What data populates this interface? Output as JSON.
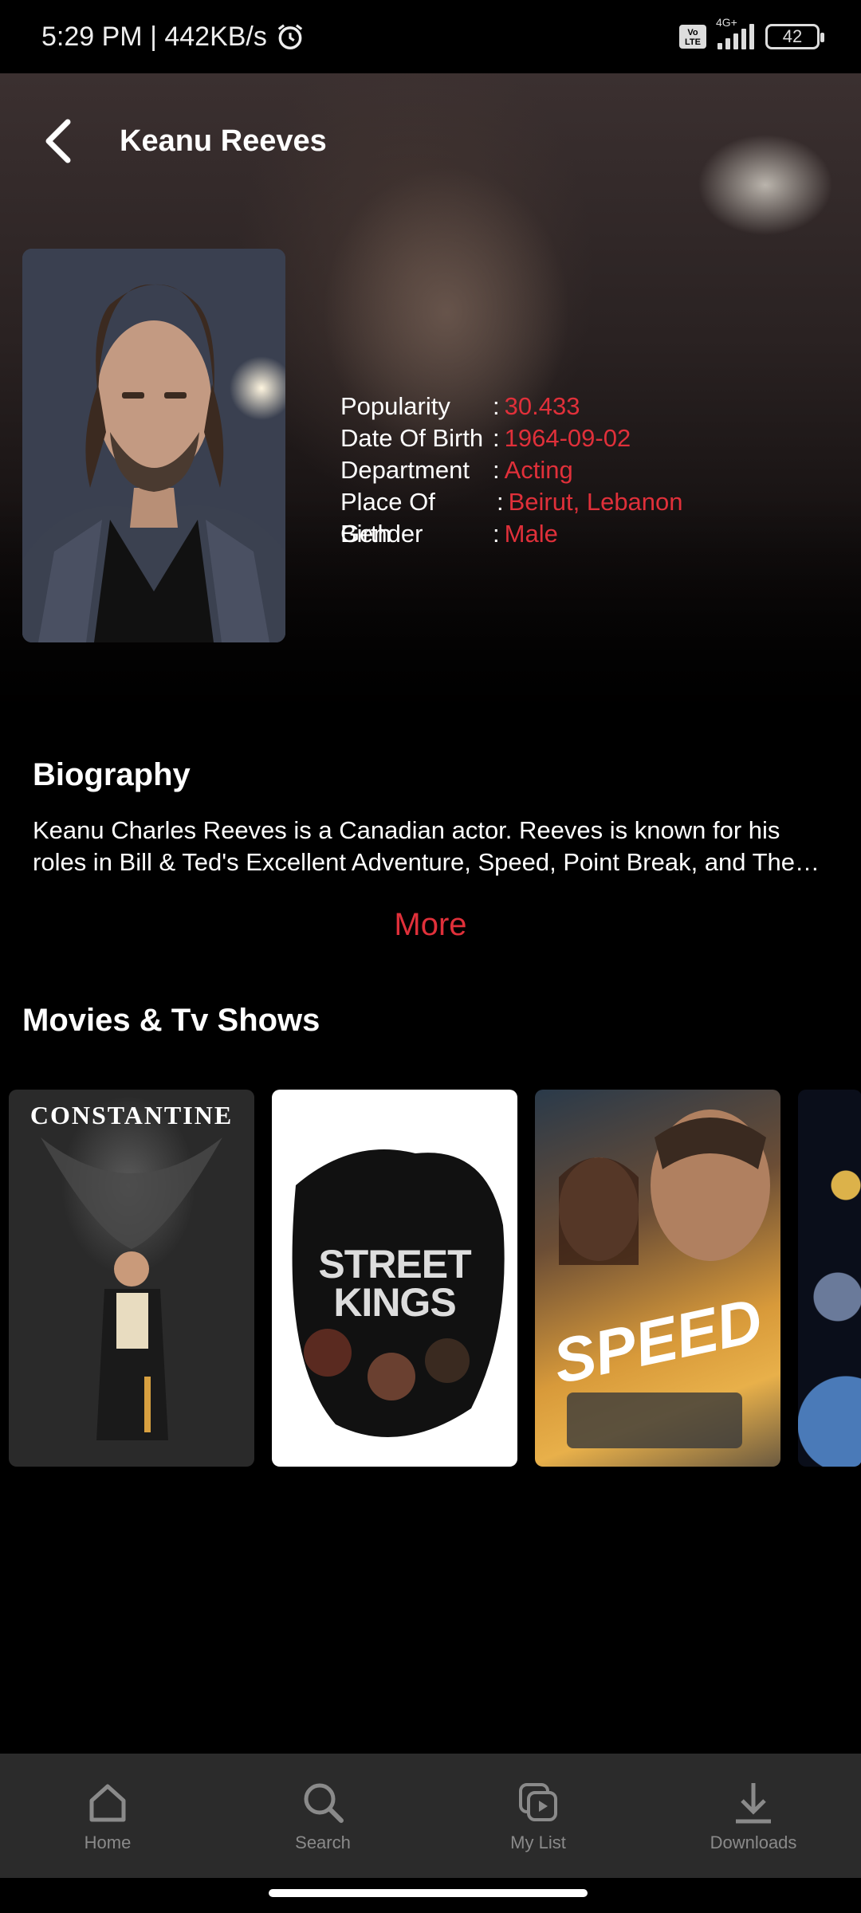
{
  "status_bar": {
    "time_speed": "5:29 PM | 442KB/s",
    "volte": "Vo LTE",
    "network": "4G+",
    "battery": "42"
  },
  "header": {
    "title": "Keanu Reeves"
  },
  "profile": {
    "info": [
      {
        "label": "Popularity",
        "value": "30.433"
      },
      {
        "label": "Date Of Birth",
        "value": "1964-09-02"
      },
      {
        "label": "Department",
        "value": "Acting"
      },
      {
        "label": "Place Of Birth",
        "value": "Beirut, Lebanon"
      },
      {
        "label": "Gender",
        "value": "Male"
      }
    ]
  },
  "biography": {
    "title": "Biography",
    "text": "Keanu Charles Reeves is a Canadian actor. Reeves is known for his roles in Bill & Ted's Excellent Adventure, Speed, Point Break, and The Matrix trilogy.",
    "more_label": "More"
  },
  "movies": {
    "title": "Movies & Tv Shows",
    "items": [
      {
        "title": "CONSTANTINE"
      },
      {
        "title": "STREET KINGS"
      },
      {
        "title": "SPEED"
      }
    ]
  },
  "bottom_nav": [
    {
      "label": "Home",
      "icon": "home-icon"
    },
    {
      "label": "Search",
      "icon": "search-icon"
    },
    {
      "label": "My List",
      "icon": "my-list-icon"
    },
    {
      "label": "Downloads",
      "icon": "download-icon"
    }
  ]
}
